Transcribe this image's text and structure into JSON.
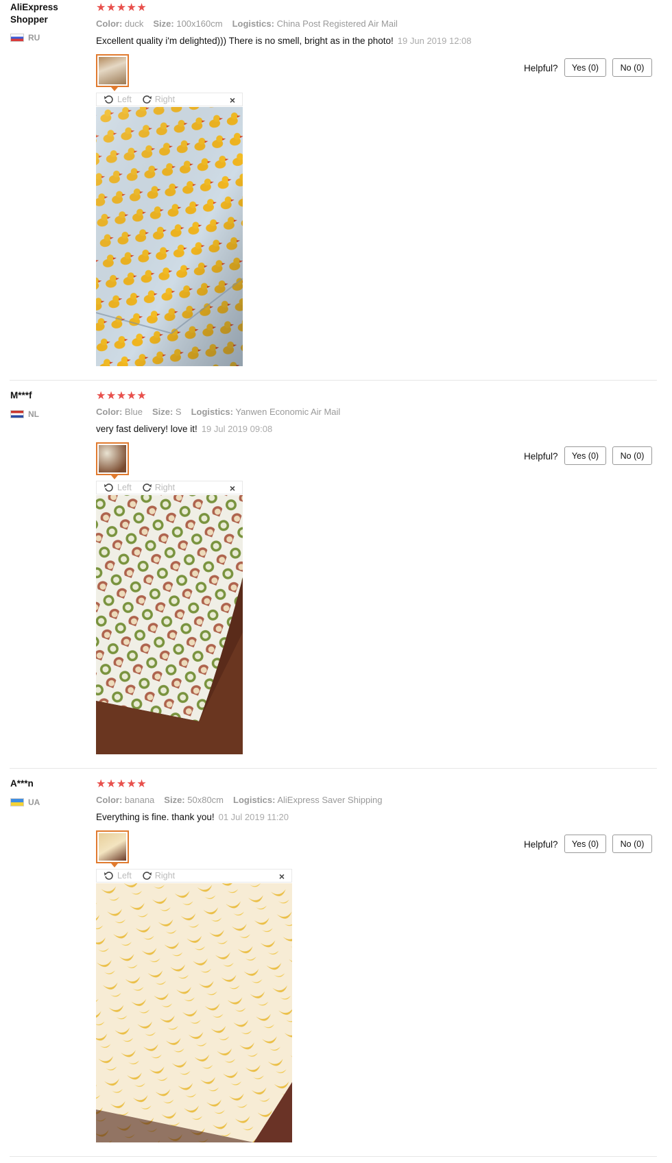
{
  "reviews": [
    {
      "user": "AliExpress Shopper",
      "country": "RU",
      "stars": "★★★★★",
      "props": [
        {
          "label": "Color:",
          "value": "duck"
        },
        {
          "label": "Size:",
          "value": "100x160cm"
        },
        {
          "label": "Logistics:",
          "value": "China Post Registered Air Mail"
        }
      ],
      "text": "Excellent quality i'm delighted))) There is no smell, bright as in the photo!",
      "date": "19 Jun 2019 12:08",
      "viewer": {
        "left": "Left",
        "right": "Right",
        "close": "×"
      },
      "helpful": "Helpful?",
      "yes": "Yes (0)",
      "no": "No (0)"
    },
    {
      "user": "M***f",
      "country": "NL",
      "stars": "★★★★★",
      "props": [
        {
          "label": "Color:",
          "value": "Blue"
        },
        {
          "label": "Size:",
          "value": "S"
        },
        {
          "label": "Logistics:",
          "value": "Yanwen Economic Air Mail"
        }
      ],
      "text": "very fast delivery! love it!",
      "date": "19 Jul 2019 09:08",
      "viewer": {
        "left": "Left",
        "right": "Right",
        "close": "×"
      },
      "helpful": "Helpful?",
      "yes": "Yes (0)",
      "no": "No (0)"
    },
    {
      "user": "A***n",
      "country": "UA",
      "stars": "★★★★★",
      "props": [
        {
          "label": "Color:",
          "value": "banana"
        },
        {
          "label": "Size:",
          "value": "50x80cm"
        },
        {
          "label": "Logistics:",
          "value": "AliExpress Saver Shipping"
        }
      ],
      "text": "Everything is fine. thank you!",
      "date": "01 Jul 2019 11:20",
      "viewer": {
        "left": "Left",
        "right": "Right",
        "close": "×"
      },
      "helpful": "Helpful?",
      "yes": "Yes (0)",
      "no": "No (0)"
    }
  ],
  "colors": {
    "star": "#e8504c",
    "thumb_border": "#e07a2e",
    "divider": "#e6e6e6"
  }
}
